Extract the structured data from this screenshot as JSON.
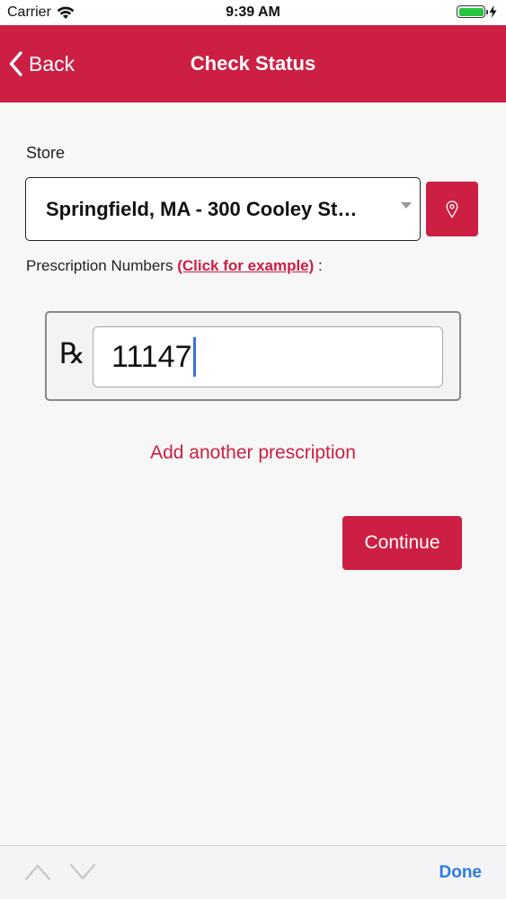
{
  "status_bar": {
    "carrier": "Carrier",
    "time": "9:39 AM",
    "battery_level": 1.0,
    "icons": [
      "wifi-icon",
      "battery-icon",
      "charging-bolt-icon"
    ]
  },
  "nav": {
    "back_label": "Back",
    "title": "Check Status"
  },
  "form": {
    "store_label": "Store",
    "store_value": "Springfield, MA - 300 Cooley St…",
    "rx_label": "Prescription Numbers",
    "rx_example_link": "(Click for example)",
    "rx_label_suffix": ":",
    "rx_symbol": "℞",
    "rx_value": "11147",
    "add_link": "Add another prescription",
    "continue_label": "Continue"
  },
  "accessory": {
    "done_label": "Done"
  },
  "colors": {
    "brand": "#cc1f43",
    "done": "#2a7be0",
    "battery": "#27c641"
  }
}
